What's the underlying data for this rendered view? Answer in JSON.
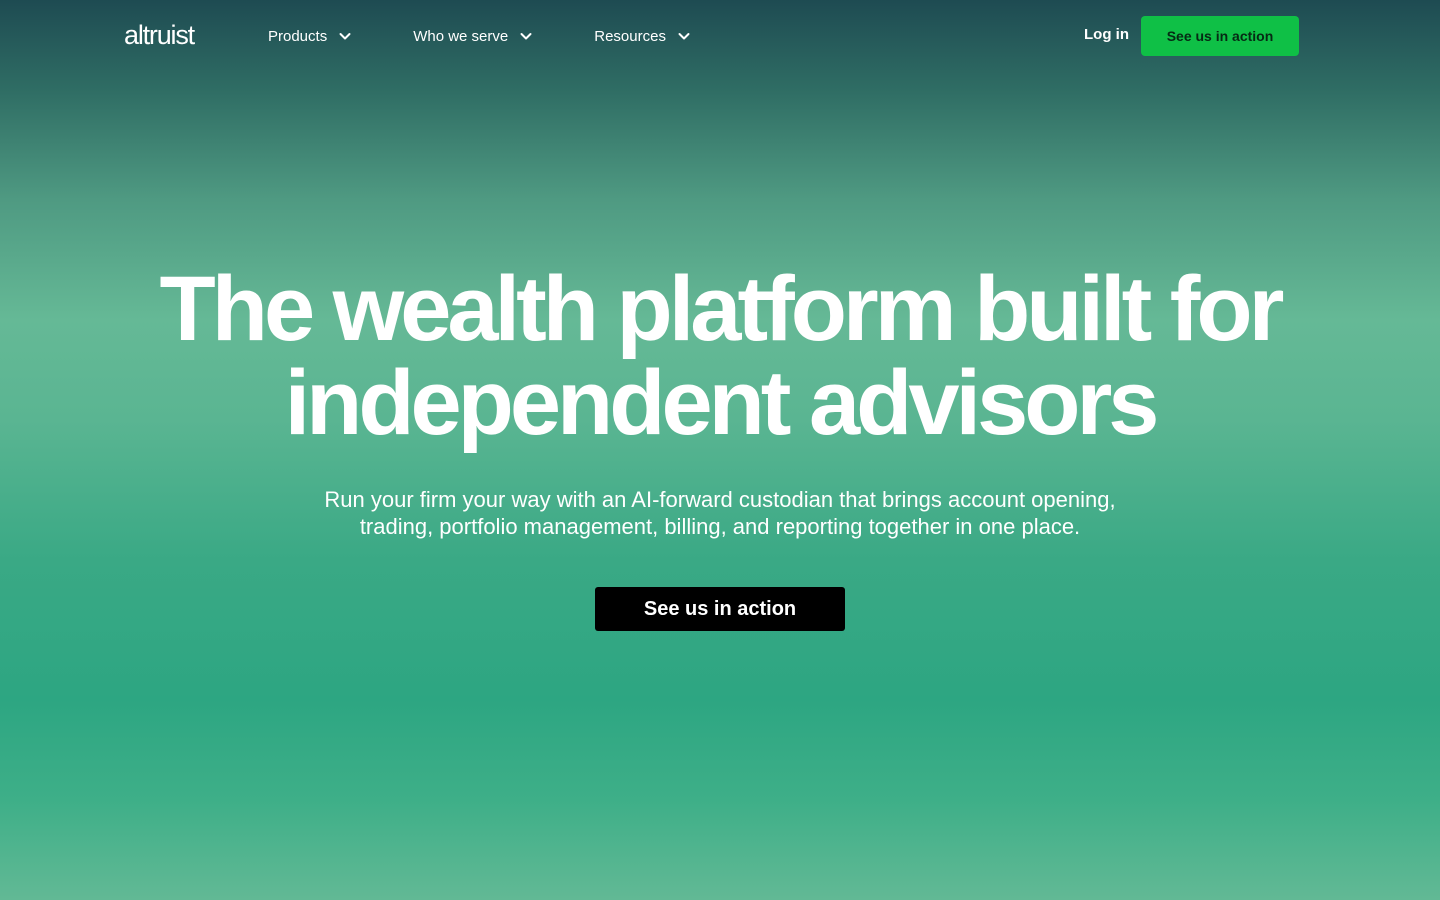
{
  "header": {
    "logo_text": "altruist",
    "nav": [
      {
        "label": "Products",
        "icon": "chevron-down-icon"
      },
      {
        "label": "Who we serve",
        "icon": "chevron-down-icon"
      },
      {
        "label": "Resources",
        "icon": "chevron-down-icon"
      }
    ],
    "login_label": "Log in",
    "cta_label": "See us in action"
  },
  "hero": {
    "title_line1": "The wealth platform built for",
    "title_line2": "independent advisors",
    "subtitle_line1": "Run your firm your way with an AI-forward custodian that brings account opening,",
    "subtitle_line2": "trading, portfolio management, billing, and reporting together in one place.",
    "cta_label": "See us in action"
  },
  "colors": {
    "accent_green": "#0fc046",
    "hero_button": "#000000",
    "background_top": "#1e4b52",
    "background_mid": "#65b996",
    "background_low": "#2da682"
  }
}
